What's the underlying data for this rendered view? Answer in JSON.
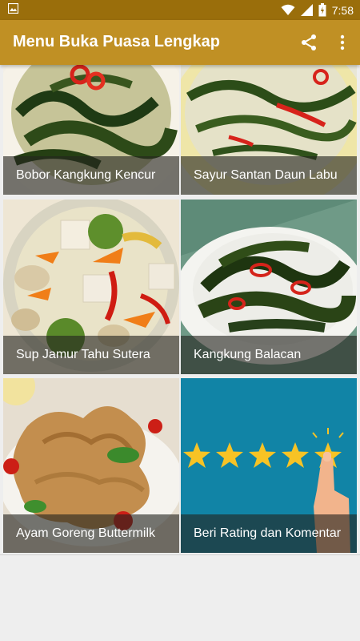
{
  "status_bar": {
    "time": "7:58",
    "icons": [
      "image-icon",
      "wifi-icon",
      "signal-icon",
      "battery-icon"
    ]
  },
  "app_bar": {
    "title": "Menu Buka Puasa Lengkap",
    "actions": [
      "share-icon",
      "more-vert-icon"
    ]
  },
  "menu": {
    "items": [
      {
        "label": "Bobor Kangkung Kencur"
      },
      {
        "label": "Sayur Santan Daun Labu"
      },
      {
        "label": "Sup Jamur Tahu Sutera"
      },
      {
        "label": "Kangkung Balacan"
      },
      {
        "label": "Ayam Goreng Buttermilk"
      },
      {
        "label": "Beri Rating dan Komentar"
      }
    ]
  },
  "colors": {
    "status_bar": "#9a6e0b",
    "app_bar": "#c09024",
    "background": "#eeeeee"
  }
}
